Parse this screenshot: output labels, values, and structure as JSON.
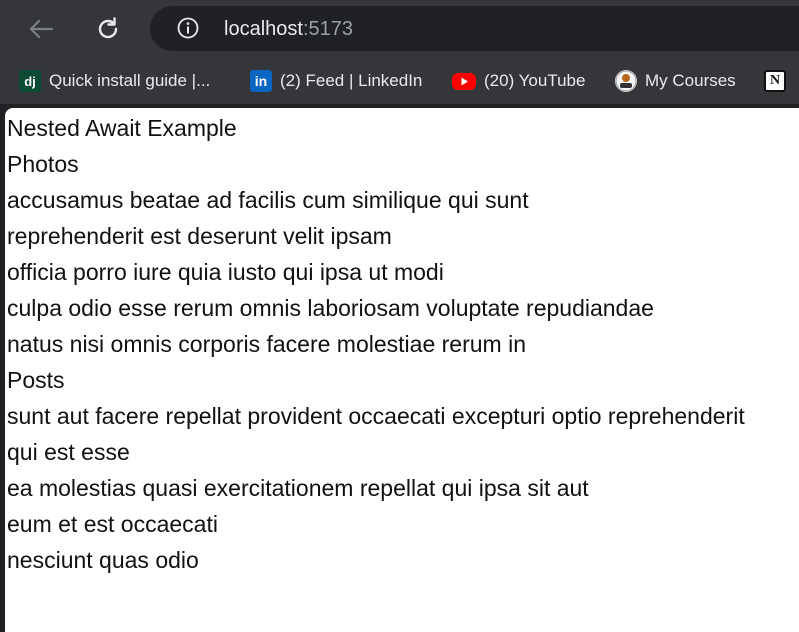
{
  "browser": {
    "url_host": "localhost",
    "url_port": ":5173",
    "bookmarks": [
      {
        "label": "Quick install guide |...",
        "icon": "django-icon"
      },
      {
        "label": "(2) Feed | LinkedIn",
        "icon": "linkedin-icon"
      },
      {
        "label": "(20) YouTube",
        "icon": "youtube-icon"
      },
      {
        "label": "My Courses",
        "icon": "courses-icon"
      }
    ]
  },
  "page": {
    "title": "Nested Await Example",
    "photos_heading": "Photos",
    "photos": [
      "accusamus beatae ad facilis cum similique qui sunt",
      "reprehenderit est deserunt velit ipsam",
      "officia porro iure quia iusto qui ipsa ut modi",
      "culpa odio esse rerum omnis laboriosam voluptate repudiandae",
      "natus nisi omnis corporis facere molestiae rerum in"
    ],
    "posts_heading": "Posts",
    "posts": [
      "sunt aut facere repellat provident occaecati excepturi optio reprehenderit",
      "qui est esse",
      "ea molestias quasi exercitationem repellat qui ipsa sit aut",
      "eum et est occaecati",
      "nesciunt quas odio"
    ]
  }
}
